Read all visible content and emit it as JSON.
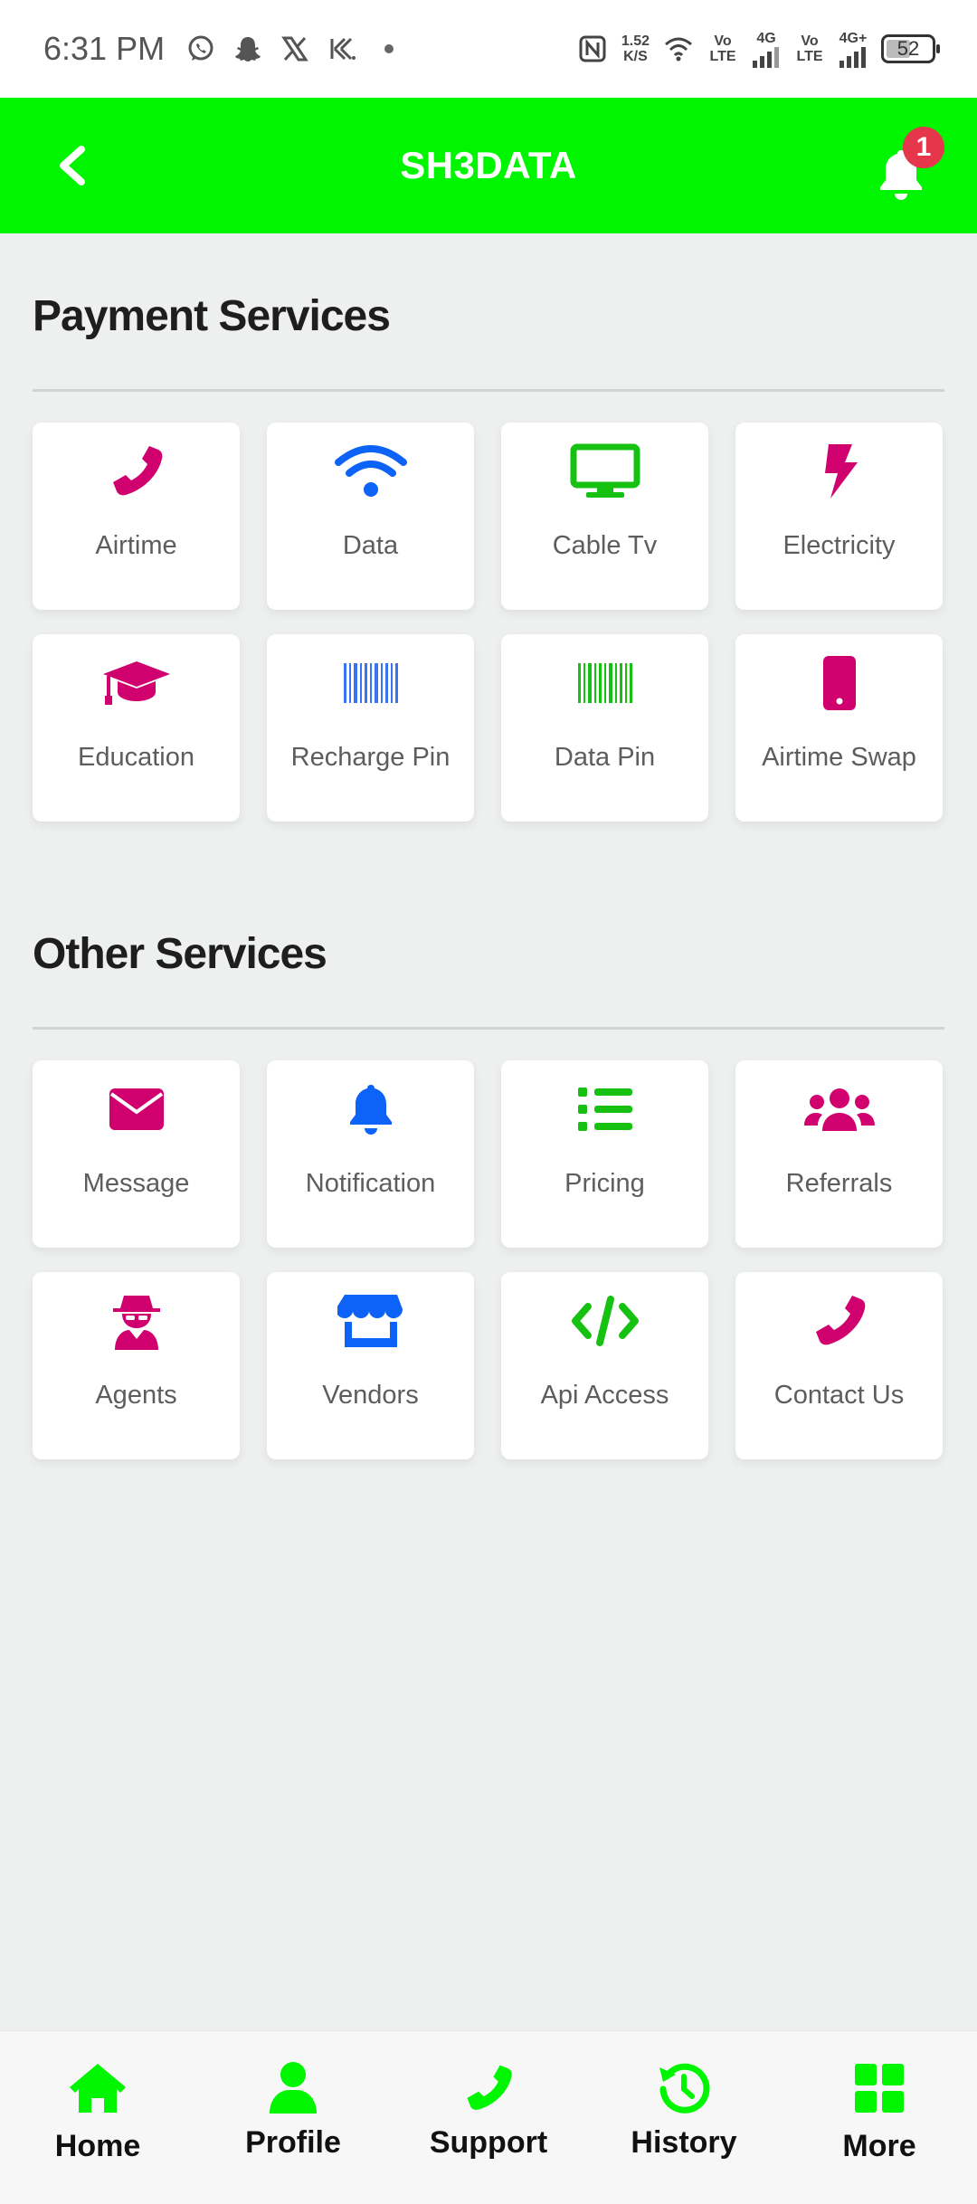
{
  "status_bar": {
    "time": "6:31 PM",
    "speed_value": "1.52",
    "speed_unit": "K/S",
    "volte1": "Vo LTE",
    "net1": "4G",
    "volte2": "Vo LTE",
    "net2": "4G+",
    "battery": "52"
  },
  "app_bar": {
    "title": "SH3DATA",
    "notification_count": "1"
  },
  "colors": {
    "green": "#00f500",
    "magenta": "#d0006f",
    "blue": "#0d63f8",
    "icon_green": "#17c111"
  },
  "payment_services": {
    "title": "Payment Services",
    "items": [
      {
        "label": "Airtime",
        "icon": "phone-icon"
      },
      {
        "label": "Data",
        "icon": "wifi-icon"
      },
      {
        "label": "Cable Tv",
        "icon": "tv-icon"
      },
      {
        "label": "Electricity",
        "icon": "bolt-icon"
      },
      {
        "label": "Education",
        "icon": "graduation-cap-icon"
      },
      {
        "label": "Recharge Pin",
        "icon": "barcode-icon"
      },
      {
        "label": "Data Pin",
        "icon": "barcode-icon"
      },
      {
        "label": "Airtime Swap",
        "icon": "mobile-icon"
      }
    ]
  },
  "other_services": {
    "title": "Other Services",
    "items": [
      {
        "label": "Message",
        "icon": "envelope-icon"
      },
      {
        "label": "Notification",
        "icon": "bell-icon"
      },
      {
        "label": "Pricing",
        "icon": "list-icon"
      },
      {
        "label": "Referrals",
        "icon": "users-icon"
      },
      {
        "label": "Agents",
        "icon": "spy-icon"
      },
      {
        "label": "Vendors",
        "icon": "store-icon"
      },
      {
        "label": "Api Access",
        "icon": "code-icon"
      },
      {
        "label": "Contact Us",
        "icon": "phone-icon"
      }
    ]
  },
  "bottom_nav": [
    {
      "label": "Home",
      "icon": "home-icon"
    },
    {
      "label": "Profile",
      "icon": "user-icon"
    },
    {
      "label": "Support",
      "icon": "phone-icon"
    },
    {
      "label": "History",
      "icon": "history-icon"
    },
    {
      "label": "More",
      "icon": "grid-icon"
    }
  ]
}
